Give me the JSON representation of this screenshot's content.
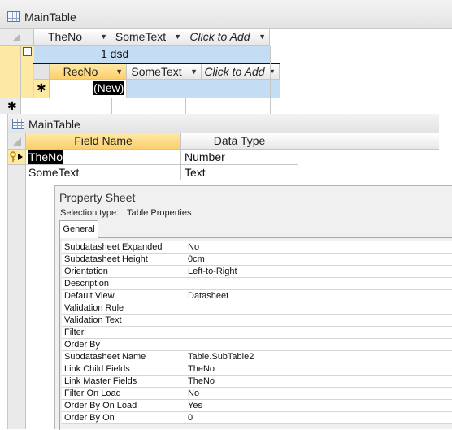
{
  "main_table_top": {
    "title": "MainTable",
    "columns": [
      {
        "label": "TheNo"
      },
      {
        "label": "SomeText"
      },
      {
        "label": "Click to Add"
      }
    ],
    "expand_symbol": "−",
    "row": {
      "value": "1 dsd"
    },
    "subdatasheet": {
      "columns": [
        {
          "label": "RecNo"
        },
        {
          "label": "SomeText"
        },
        {
          "label": "Click to Add"
        }
      ],
      "new_row_marker": "✱",
      "new_row_value": "(New)"
    },
    "new_row_marker": "✱"
  },
  "main_table_design": {
    "title": "MainTable",
    "headers": {
      "field_name": "Field Name",
      "data_type": "Data Type"
    },
    "rows": [
      {
        "field_name": "TheNo",
        "data_type": "Number"
      },
      {
        "field_name": "SomeText",
        "data_type": "Text"
      }
    ]
  },
  "property_sheet": {
    "title": "Property Sheet",
    "selection_type_label": "Selection type:",
    "selection_type_value": "Table Properties",
    "tab": "General",
    "properties": [
      {
        "name": "Subdatasheet Expanded",
        "value": "No"
      },
      {
        "name": "Subdatasheet Height",
        "value": "0cm"
      },
      {
        "name": "Orientation",
        "value": "Left-to-Right"
      },
      {
        "name": "Description",
        "value": ""
      },
      {
        "name": "Default View",
        "value": "Datasheet"
      },
      {
        "name": "Validation Rule",
        "value": ""
      },
      {
        "name": "Validation Text",
        "value": ""
      },
      {
        "name": "Filter",
        "value": ""
      },
      {
        "name": "Order By",
        "value": ""
      },
      {
        "name": "Subdatasheet Name",
        "value": "Table.SubTable2"
      },
      {
        "name": "Link Child Fields",
        "value": "TheNo"
      },
      {
        "name": "Link Master Fields",
        "value": "TheNo"
      },
      {
        "name": "Filter On Load",
        "value": "No"
      },
      {
        "name": "Order By On Load",
        "value": "Yes"
      },
      {
        "name": "Order By On",
        "value": "0"
      }
    ]
  },
  "colors": {
    "row_selector_highlight": "#fde9a3",
    "selected_row_blue": "#c5dcf5",
    "active_header": "#fce08a",
    "selected_text_bg": "#000000"
  }
}
